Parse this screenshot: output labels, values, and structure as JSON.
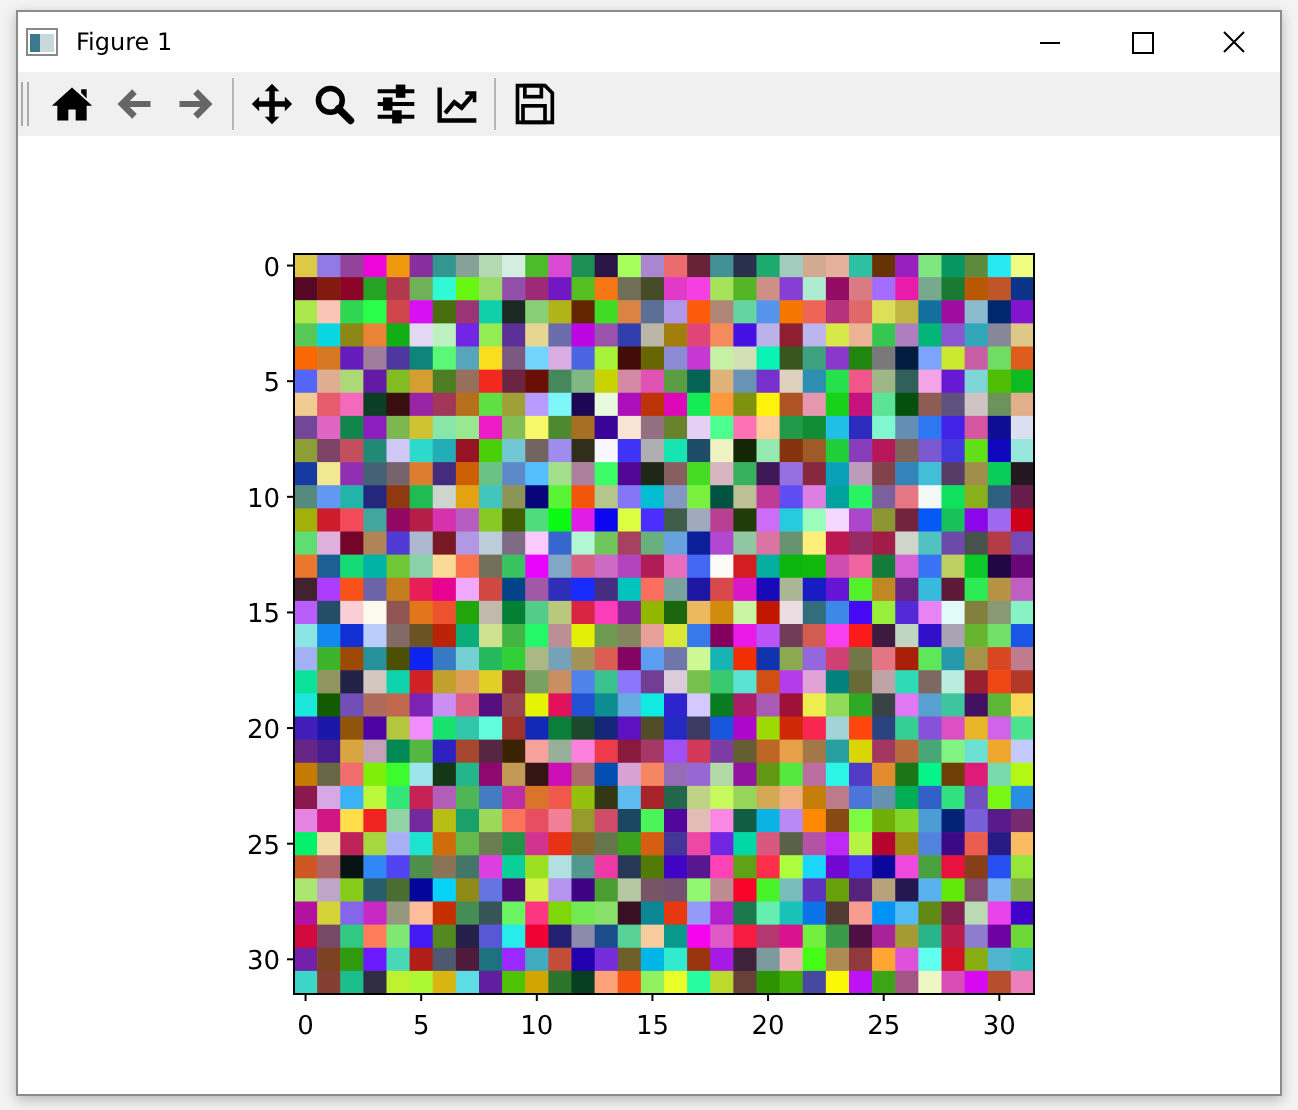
{
  "window": {
    "title": "Figure 1"
  },
  "toolbar": {
    "groups": [
      [
        {
          "kind": "home",
          "disabled": false
        },
        {
          "kind": "back",
          "disabled": true
        },
        {
          "kind": "forward",
          "disabled": true
        }
      ],
      [
        {
          "kind": "pan",
          "disabled": false
        },
        {
          "kind": "zoom",
          "disabled": false
        },
        {
          "kind": "subplots",
          "disabled": false
        },
        {
          "kind": "customize",
          "disabled": false
        }
      ],
      [
        {
          "kind": "save",
          "disabled": false
        }
      ]
    ]
  },
  "axes": {
    "xticks": [
      "0",
      "5",
      "10",
      "15",
      "20",
      "25",
      "30"
    ],
    "yticks": [
      "0",
      "5",
      "10",
      "15",
      "20",
      "25",
      "30"
    ]
  }
}
